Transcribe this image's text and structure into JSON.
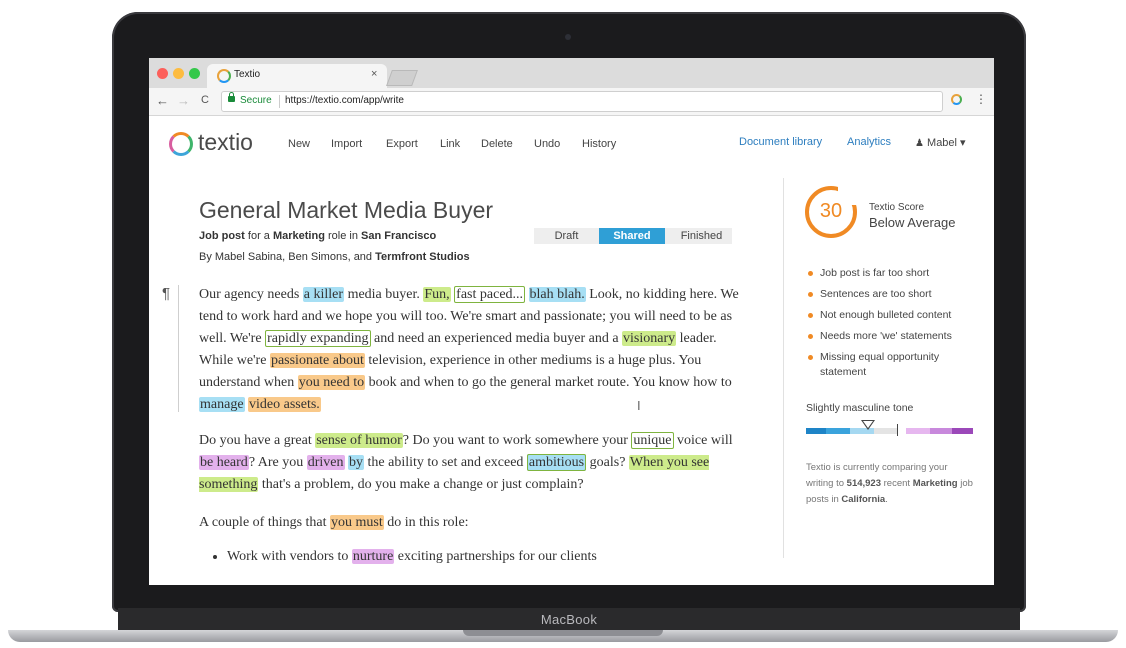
{
  "device": {
    "brand": "MacBook"
  },
  "browser": {
    "tab_title": "Textio",
    "tab_close": "×",
    "back": "←",
    "forward": "→",
    "reload": "C",
    "security_label": "Secure",
    "url": "https://textio.com/app/write",
    "menu": "⋮",
    "window_dot_colors": [
      "#fc605b",
      "#fdbc40",
      "#34c84a"
    ]
  },
  "app": {
    "logo": "textio",
    "nav": [
      "New",
      "Import",
      "Export",
      "Link",
      "Delete",
      "Undo",
      "History"
    ],
    "links": [
      "Document library",
      "Analytics"
    ],
    "user": "Mabel ▾",
    "user_icon": "person-icon"
  },
  "document": {
    "title": "General Market Media Buyer",
    "subtitle_parts": [
      "Job post",
      " for a ",
      "Marketing",
      " role in ",
      "San Francisco"
    ],
    "authors": [
      "By Mabel Sabina, Ben Simons, and ",
      "Termfront Studios"
    ],
    "status_steps": [
      "Draft",
      "Shared",
      "Finished"
    ],
    "active_status": "Shared",
    "pilcrow": "¶",
    "cursor": "I",
    "paragraph1": [
      "Our agency needs ",
      "a killer",
      " media buyer. ",
      "Fun,",
      " ",
      "fast paced...",
      " ",
      "blah blah.",
      " Look, no kidding here. We tend to work hard and we hope you will too. We're smart and passionate; you will need to be as well. We're ",
      "rapidly expanding",
      " and need an experienced media buyer and a ",
      "visionary",
      " leader. While we're ",
      "passionate about",
      " television, experience in other mediums is a huge plus. You understand when ",
      "you need to",
      " book and when to go the general market route. You know how to ",
      "manage",
      " ",
      "video assets."
    ],
    "paragraph2": [
      "Do you have a great ",
      "sense of humor",
      "? Do you want to work somewhere your ",
      "unique",
      " voice will ",
      "be heard",
      "? Are you ",
      "driven",
      " ",
      "by",
      " the ability to set and exceed ",
      "ambitious",
      " goals? ",
      "When you see something",
      " that's a problem, do you make a change or just complain?"
    ],
    "paragraph3": [
      "A couple of things that ",
      "you must",
      " do in this role:"
    ],
    "bullet1": [
      "Work with vendors to ",
      "nurture",
      " exciting partnerships for our clients"
    ]
  },
  "sidebar": {
    "score": "30",
    "score_label": "Textio Score",
    "score_rating": "Below Average",
    "issues": [
      "Job post is far too short",
      "Sentences are too short",
      "Not enough bulleted content",
      "Needs more 'we' statements",
      "Missing equal opportunity statement"
    ],
    "tone_label": "Slightly masculine tone",
    "compare_parts": [
      "Textio is currently comparing your writing to ",
      "514,923",
      " recent ",
      "Marketing",
      " job posts in ",
      "California",
      "."
    ]
  },
  "colors": {
    "accent_orange": "#f08a24",
    "link_blue": "#2d7ebf",
    "status_active": "#2f9fd6",
    "hl_blue": "#a7dff4",
    "hl_green": "#cdeb8b",
    "hl_orange": "#f9c98a",
    "hl_pink": "#e3b1ec"
  }
}
